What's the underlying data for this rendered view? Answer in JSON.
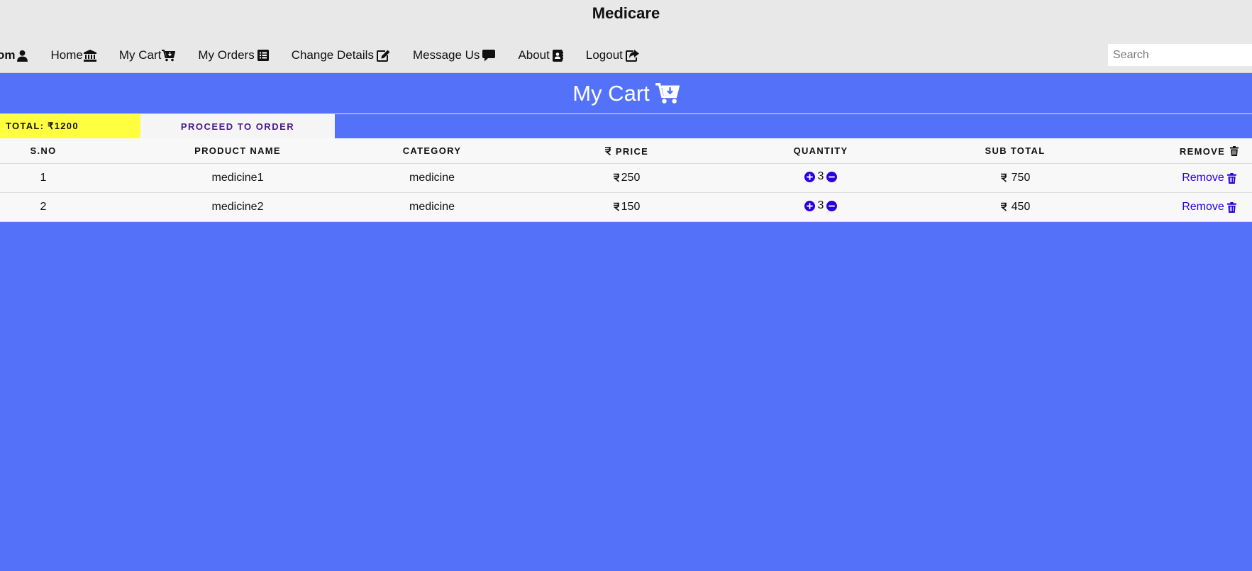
{
  "header": {
    "title": "Medicare",
    "nav": [
      {
        "label": "om",
        "icon": "user-icon"
      },
      {
        "label": "Home",
        "icon": "bank-icon"
      },
      {
        "label": "My Cart",
        "icon": "cart-icon"
      },
      {
        "label": "My Orders",
        "icon": "list-icon"
      },
      {
        "label": "Change Details",
        "icon": "edit-icon"
      },
      {
        "label": "Message Us",
        "icon": "comment-icon"
      },
      {
        "label": "About",
        "icon": "address-book-icon"
      },
      {
        "label": "Logout",
        "icon": "share-icon"
      }
    ],
    "search_placeholder": "Search"
  },
  "page": {
    "title": "My Cart",
    "total_label": "TOTAL: ₹1200",
    "proceed_label": "PROCEED TO ORDER"
  },
  "table": {
    "headers": {
      "sno": "S.NO",
      "name": "PRODUCT NAME",
      "category": "CATEGORY",
      "price": "PRICE",
      "quantity": "QUANTITY",
      "subtotal": "SUB TOTAL",
      "remove": "REMOVE"
    },
    "rows": [
      {
        "sno": "1",
        "name": "medicine1",
        "category": "medicine",
        "price": "250",
        "quantity": "3",
        "subtotal": "750",
        "remove": "Remove"
      },
      {
        "sno": "2",
        "name": "medicine2",
        "category": "medicine",
        "price": "150",
        "quantity": "3",
        "subtotal": "450",
        "remove": "Remove"
      }
    ]
  },
  "colors": {
    "background": "#5472f9",
    "header_bg": "#e8e8e8",
    "total_bg": "#ffff40",
    "link": "#2a00e0",
    "qty_icon": "#2a00e0"
  }
}
